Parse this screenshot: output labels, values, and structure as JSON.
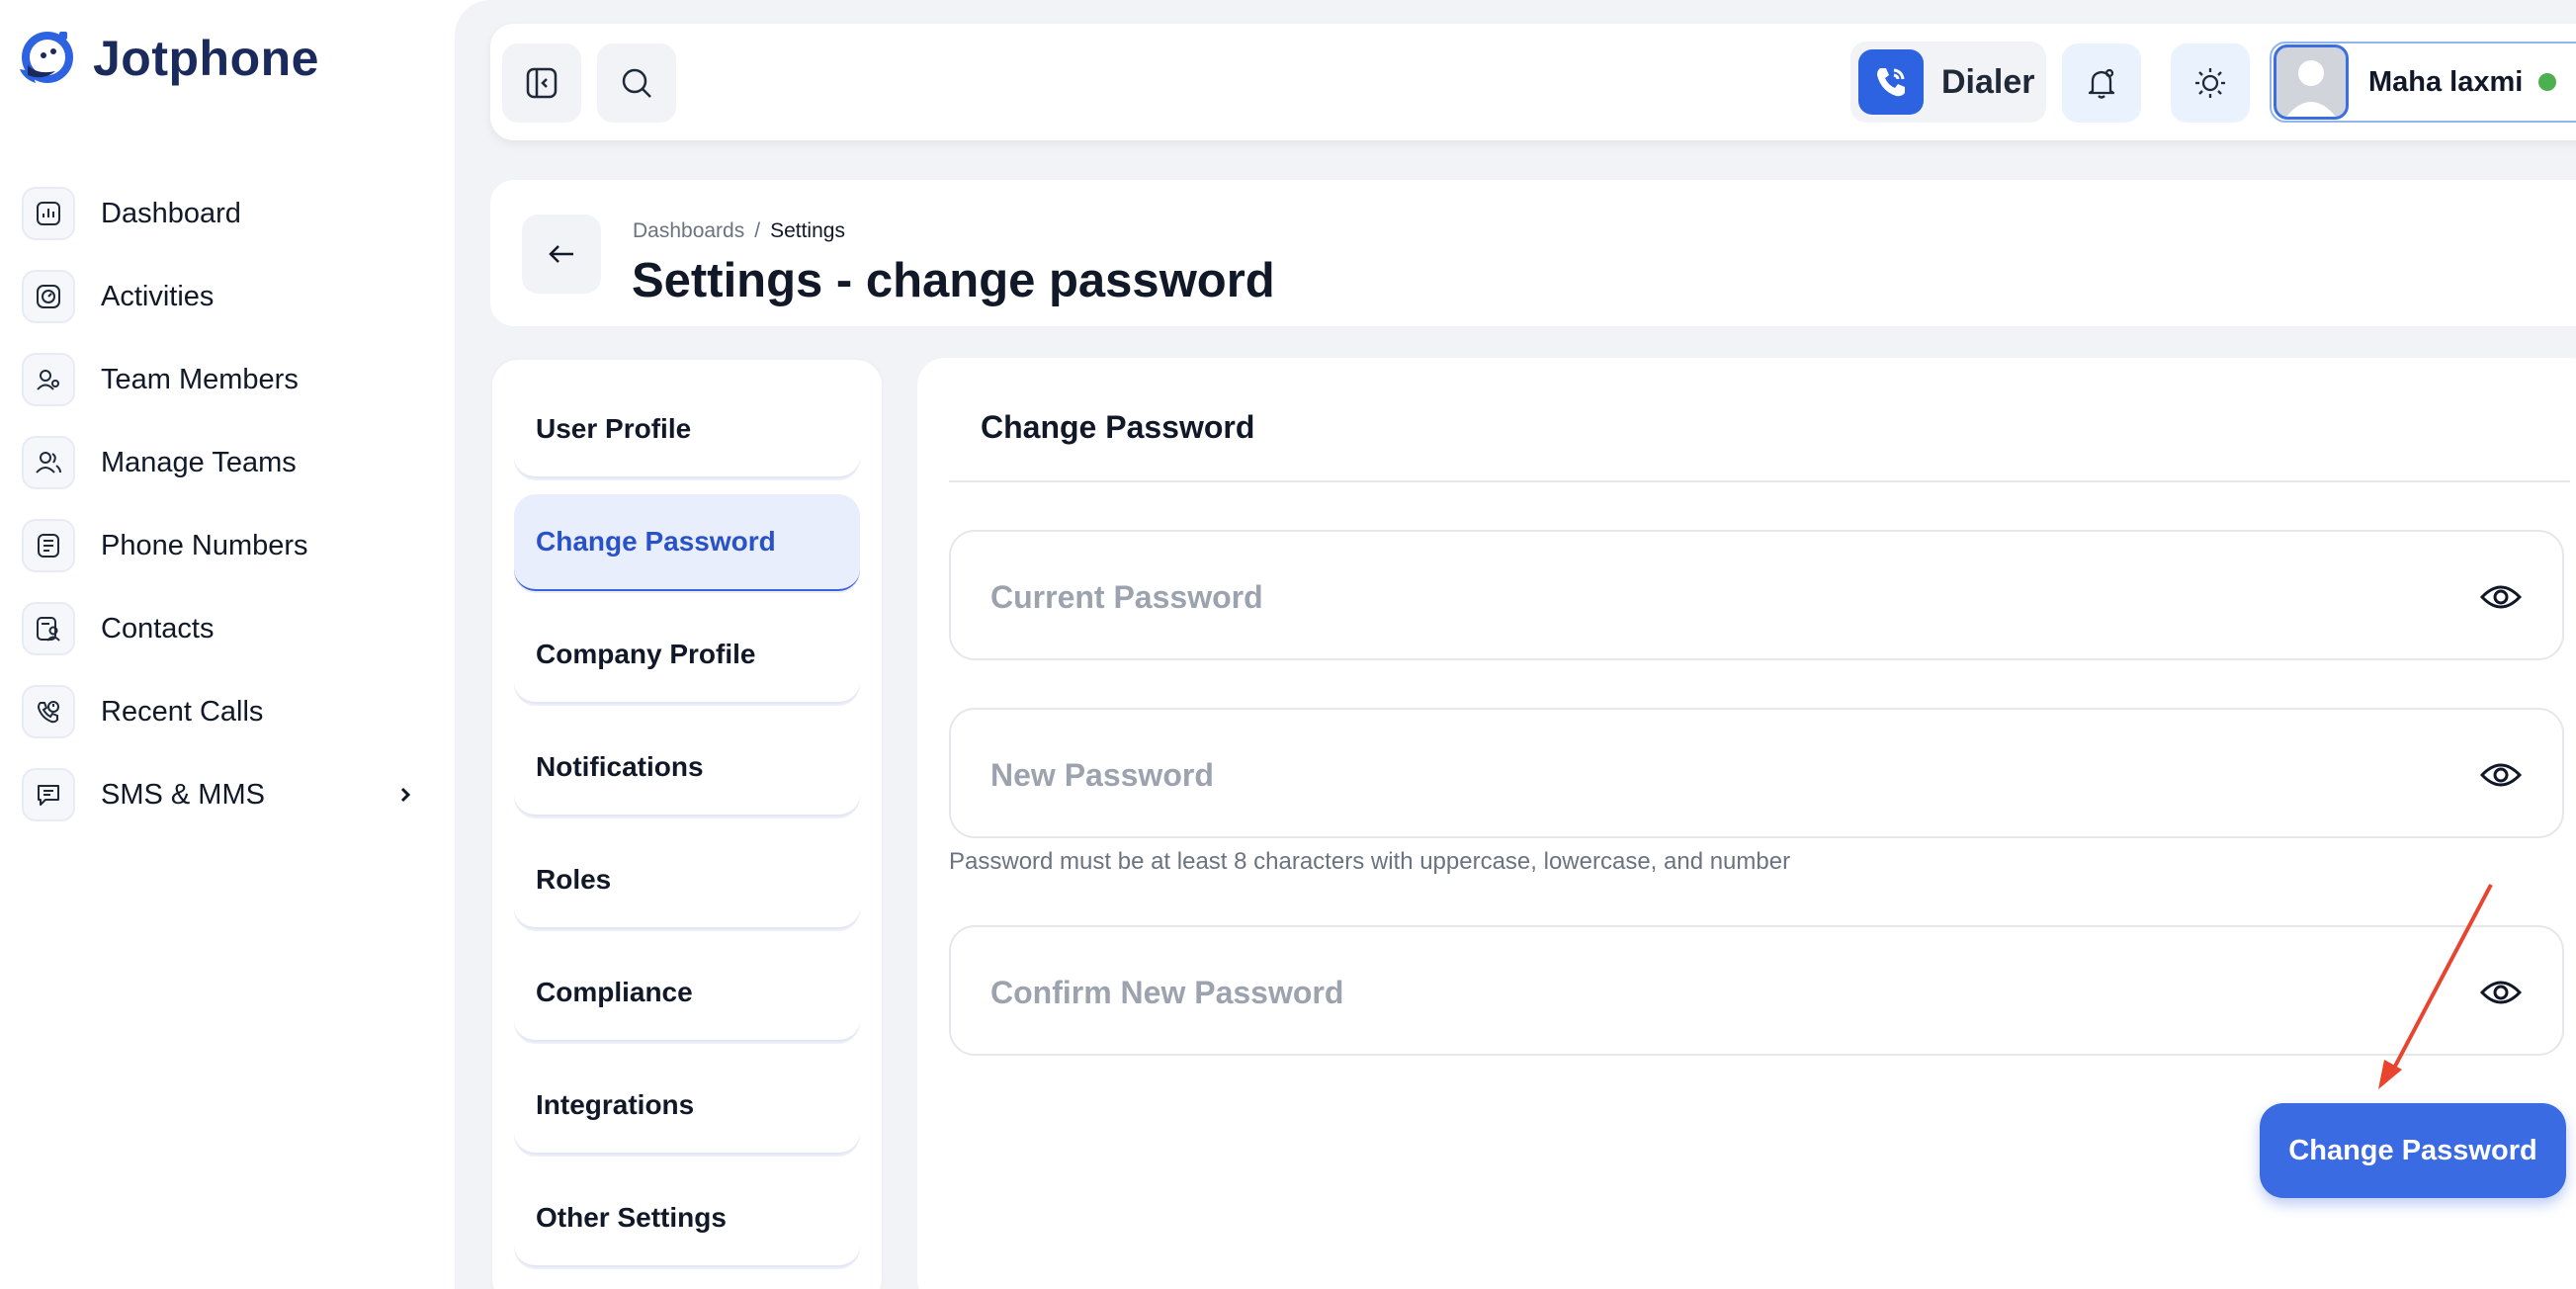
{
  "brand": {
    "name": "Jotphone"
  },
  "sidebar": {
    "items": [
      {
        "label": "Dashboard",
        "icon": "dashboard-icon"
      },
      {
        "label": "Activities",
        "icon": "activities-icon"
      },
      {
        "label": "Team Members",
        "icon": "team-members-icon"
      },
      {
        "label": "Manage Teams",
        "icon": "manage-teams-icon"
      },
      {
        "label": "Phone Numbers",
        "icon": "phone-numbers-icon"
      },
      {
        "label": "Contacts",
        "icon": "contacts-icon"
      },
      {
        "label": "Recent Calls",
        "icon": "recent-calls-icon"
      },
      {
        "label": "SMS & MMS",
        "icon": "sms-icon",
        "has_submenu": true
      }
    ]
  },
  "topbar": {
    "dialer_label": "Dialer",
    "user_name": "Maha laxmi",
    "user_status": "online"
  },
  "header": {
    "breadcrumb": [
      "Dashboards",
      "Settings"
    ],
    "breadcrumb_separator": "/",
    "title": "Settings - change password"
  },
  "settings_menu": {
    "items": [
      "User Profile",
      "Change Password",
      "Company Profile",
      "Notifications",
      "Roles",
      "Compliance",
      "Integrations",
      "Other Settings"
    ],
    "active": "Change Password"
  },
  "form": {
    "section_title": "Change Password",
    "current_password": {
      "placeholder": "Current Password",
      "value": ""
    },
    "new_password": {
      "placeholder": "New Password",
      "value": ""
    },
    "hint": "Password must be at least 8 characters with uppercase, lowercase, and number",
    "confirm_password": {
      "placeholder": "Confirm New Password",
      "value": ""
    },
    "submit_label": "Change Password"
  },
  "colors": {
    "accent": "#3b6be3",
    "brand_navy": "#1b2a5c",
    "active_menu_bg": "#e8eefb",
    "annotation_arrow": "#e8442e",
    "online": "#4caf50"
  }
}
